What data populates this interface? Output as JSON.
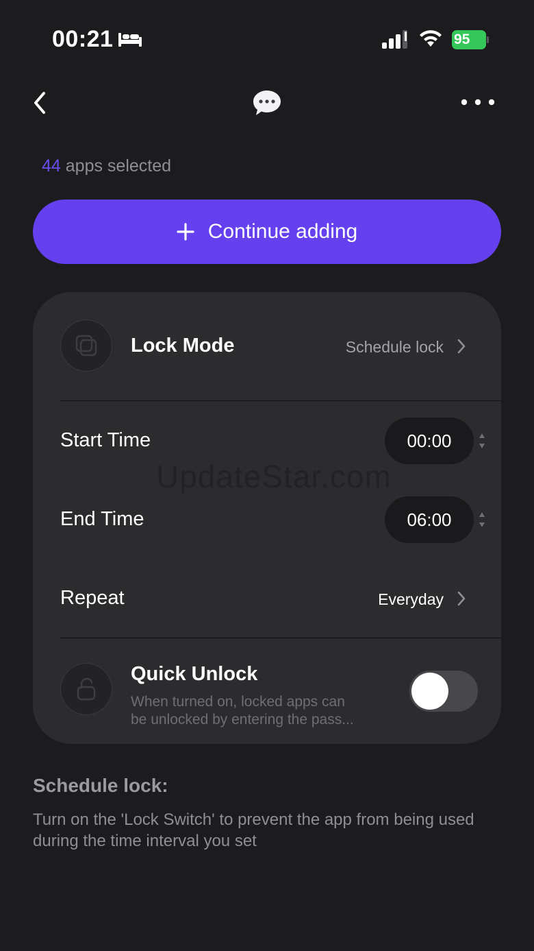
{
  "status_bar": {
    "time": "00:21",
    "battery_level": "95",
    "icons": [
      "bed-icon",
      "cellular-signal-icon",
      "wifi-icon",
      "battery-charging-icon"
    ],
    "battery_color": "#35c759"
  },
  "nav": {
    "back_icon": "chevron-left-icon",
    "center_icon": "chat-bubble-icon",
    "more_icon": "more-horizontal-icon"
  },
  "selection": {
    "count": "44",
    "suffix": " apps selected",
    "count_color": "#6a4cf0"
  },
  "continue_button": {
    "label": "Continue adding",
    "icon": "plus-icon",
    "color": "#6440ee"
  },
  "settings": {
    "lock_mode": {
      "label": "Lock Mode",
      "value": "Schedule lock",
      "icon": "lock-mode-icon"
    },
    "start_time": {
      "label": "Start Time",
      "value": "00:00"
    },
    "end_time": {
      "label": "End Time",
      "value": "06:00"
    },
    "repeat": {
      "label": "Repeat",
      "value": "Everyday"
    },
    "quick_unlock": {
      "label": "Quick Unlock",
      "description_line1": "When turned on, locked apps can",
      "description_line2": "be unlocked by entering the pass...",
      "enabled": false,
      "icon": "unlock-icon"
    }
  },
  "watermark": "UpdateStar.com",
  "explanation": {
    "title": "Schedule lock:",
    "body": "Turn on the 'Lock Switch' to prevent the app from being used during the time interval you set"
  }
}
